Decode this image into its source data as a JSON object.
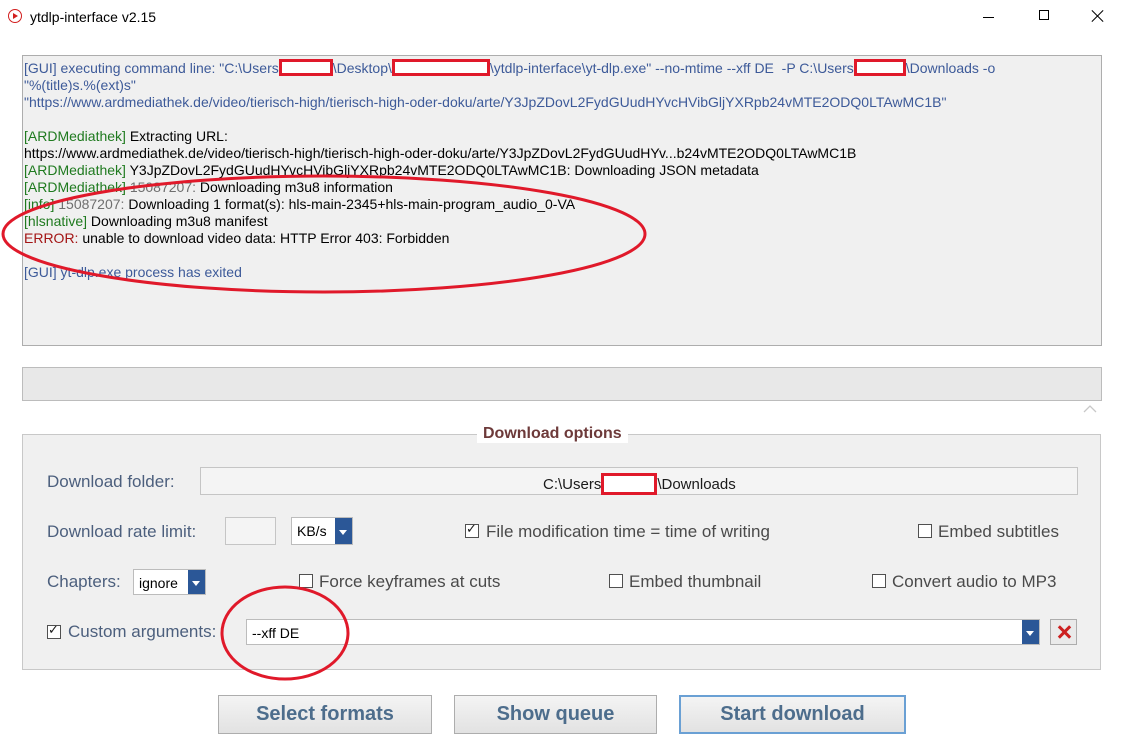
{
  "window": {
    "title": "ytdlp-interface v2.15"
  },
  "console": {
    "cmd_line1_part1": "[GUI] executing command line: \"C:\\Users",
    "cmd_line1_part2": "\\Desktop\\",
    "cmd_line1_part3": "\\ytdlp-interface\\yt-dlp.exe\" --no-mtime --xff DE  -P C:\\Users",
    "cmd_line1_part4": "\\Downloads -o",
    "cmd_line2": "\"%(title)s.%(ext)s\"",
    "cmd_line3": "\"https://www.ardmediathek.de/video/tierisch-high/tierisch-high-oder-doku/arte/Y3JpZDovL2FydGUudHYvcHVibGljYXRpb24vMTE2ODQ0LTAwMC1B\"",
    "l1_tag": "[ARDMediathek]",
    "l1_text": " Extracting URL:",
    "l2_text": "https://www.ardmediathek.de/video/tierisch-high/tierisch-high-oder-doku/arte/Y3JpZDovL2FydGUudHYv...b24vMTE2ODQ0LTAwMC1B",
    "l3_tag": "[ARDMediathek]",
    "l3_text": " Y3JpZDovL2FydGUudHYvcHVibGljYXRpb24vMTE2ODQ0LTAwMC1B: Downloading JSON metadata",
    "l4_tag": "[ARDMediathek]",
    "l4_id": " 15087207:",
    "l4_text": " Downloading m3u8 information",
    "l5_tag": "[info]",
    "l5_id": " 15087207:",
    "l5_text": " Downloading 1 format(s): hls-main-2345+hls-main-program_audio_0-VA",
    "l6_tag": "[hlsnative]",
    "l6_text": " Downloading m3u8 manifest",
    "l7_tag": "ERROR:",
    "l7_text": " unable to download video data: HTTP Error 403: Forbidden",
    "exit_line": "[GUI] yt-dlp.exe process has exited"
  },
  "options": {
    "title": "Download options",
    "folder_label": "Download folder:",
    "folder_part1": "C:\\Users",
    "folder_part2": "\\Downloads",
    "rate_label": "Download rate limit:",
    "rate_value": "",
    "rate_unit": "KB/s",
    "mtime_label": "File modification time = time of writing",
    "mtime_checked": true,
    "embed_subs_label": "Embed subtitles",
    "chapters_label": "Chapters:",
    "chapters_value": "ignore",
    "force_kf_label": "Force keyframes at cuts",
    "embed_thumb_label": "Embed thumbnail",
    "convert_mp3_label": "Convert audio to MP3",
    "custom_args_label": "Custom arguments:",
    "custom_args_checked": true,
    "custom_args_value": "--xff DE"
  },
  "buttons": {
    "select_formats": "Select formats",
    "show_queue": "Show queue",
    "start_download": "Start download"
  },
  "colors": {
    "annotation_red": "#e0192a",
    "accent_blue": "#2b5797"
  }
}
